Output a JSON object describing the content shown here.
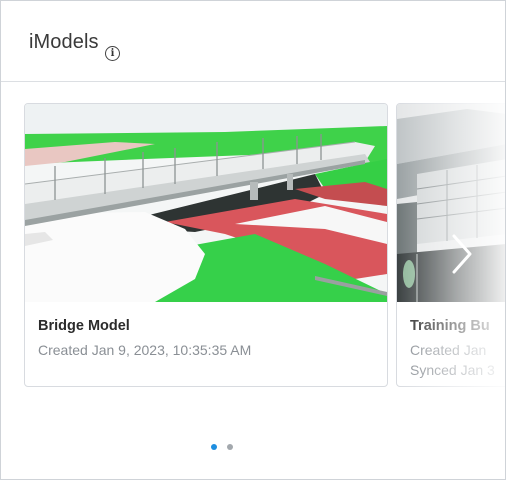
{
  "header": {
    "title": "iModels",
    "info_icon": "info-icon"
  },
  "cards": [
    {
      "name": "Bridge Model",
      "created": "Created Jan 9, 2023, 10:35:35 AM",
      "thumbnail": "bridge-render-thumbnail"
    },
    {
      "name": "Training Bu",
      "created": "Created Jan",
      "synced": "Synced Jan 3",
      "thumbnail": "building-render-thumbnail"
    }
  ],
  "carousel": {
    "next_icon": "chevron-right-icon",
    "page_count": 2,
    "active_page": 1,
    "active_color": "#1e8ee0",
    "inactive_color": "#a3a8ad"
  }
}
